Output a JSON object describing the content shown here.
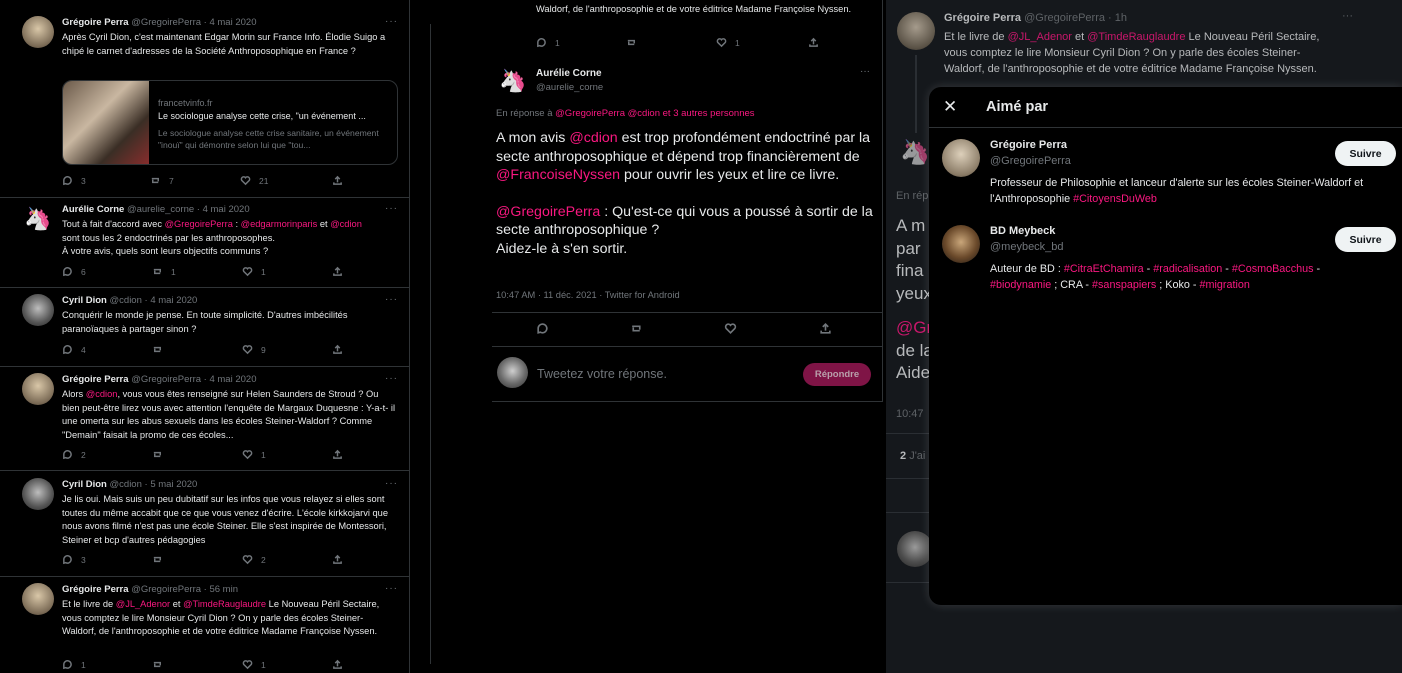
{
  "left_thread": {
    "tweets": [
      {
        "name": "Grégoire Perra",
        "handle": "@GregoirePerra",
        "time": "· 4 mai 2020",
        "text_parts": [
          "Après Cyril Dion, c'est maintenant Edgar Morin sur France Info. Élodie Suigo a chipé le carnet d'adresses de la Société Anthroposophique en France  ?"
        ],
        "card": {
          "domain": "francetvinfo.fr",
          "title": "Le sociologue analyse cette crise, \"un événement ...",
          "desc": "Le sociologue analyse cette crise sanitaire, un événement \"inouï\" qui démontre selon lui que \"tou..."
        },
        "replies": "3",
        "retweets": "7",
        "likes": "21"
      },
      {
        "name": "Aurélie Corne",
        "handle": "@aurelie_corne",
        "time": "· 4 mai 2020",
        "line1_a": "Tout à fait d'accord avec ",
        "m1": "@GregoirePerra",
        "line1_b": " : ",
        "m2": "@edgarmorinparis",
        "line1_c": " et ",
        "m3": "@cdion",
        "line2": "sont tous les 2 endoctrinés par les anthroposophes.",
        "line3": "À votre avis, quels sont leurs objectifs communs ?",
        "replies": "6",
        "retweets": "1",
        "likes": "1"
      },
      {
        "name": "Cyril Dion",
        "handle": "@cdion",
        "time": "· 4 mai 2020",
        "text": "Conquérir le monde je pense. En toute simplicité. D'autres imbécilités paranoïaques à partager sinon ?",
        "replies": "4",
        "retweets": "",
        "likes": "9"
      },
      {
        "name": "Grégoire Perra",
        "handle": "@GregoirePerra",
        "time": "· 4 mai 2020",
        "a": "Alors ",
        "m1": "@cdion",
        "b": ", vous vous êtes renseigné sur Helen Saunders de Stroud ? Ou bien peut-être lirez vous avec attention l'enquête de Margaux Duquesne : Y-a-t- il une omerta sur les abus sexuels dans les écoles Steiner-Waldorf ? Comme \"Demain\" faisait la promo de ces écoles...",
        "replies": "2",
        "retweets": "",
        "likes": "1"
      },
      {
        "name": "Cyril Dion",
        "handle": "@cdion",
        "time": "· 5 mai 2020",
        "text": "Je lis oui. Mais suis un peu dubitatif sur les infos que vous relayez si elles sont toutes du même accabit que ce que vous venez d'écrire. L'école kirkkojarvi que nous avons filmé n'est pas une école Steiner. Elle s'est inspirée de Montessori, Steiner et bcp d'autres pédagogies",
        "replies": "3",
        "retweets": "",
        "likes": "2"
      },
      {
        "name": "Grégoire Perra",
        "handle": "@GregoirePerra",
        "time": "· 56 min",
        "a": "Et le livre de ",
        "m1": "@JL_Adenor",
        "b": " et ",
        "m2": "@TimdeRauglaudre",
        "c": " Le Nouveau Péril Sectaire, vous comptez le lire Monsieur Cyril Dion ? On y parle des écoles Steiner-Waldorf, de l'anthroposophie et de votre éditrice Madame Françoise Nyssen.",
        "replies": "1",
        "retweets": "",
        "likes": "1"
      }
    ]
  },
  "middle": {
    "top_text": "Waldorf, de l'anthroposophie et de votre éditrice Madame Françoise Nyssen.",
    "top_replies": "1",
    "top_likes": "1",
    "name": "Aurélie Corne",
    "handle": "@aurelie_corne",
    "reply_to_prefix": "En réponse à ",
    "reply_to_m1": "@GregoirePerra",
    "reply_to_m2": "@cdion",
    "reply_to_suffix": " et 3 autres personnes",
    "p1a": "A mon avis ",
    "p1m1": "@cdion",
    "p1b": " est trop profondément endoctriné par la secte anthroposophique et dépend trop financièrement de ",
    "p1m2": "@FrancoiseNyssen",
    "p1c": " pour ouvrir les yeux et lire ce livre.",
    "p2m": "@GregoirePerra",
    "p2a": " : Qu'est-ce qui vous a poussé à sortir de la secte anthroposophique ?",
    "p3": "Aidez-le à s'en sortir.",
    "meta": "10:47 AM · 11 déc. 2021 · Twitter for Android",
    "reply_placeholder": "Tweetez votre réponse.",
    "reply_button": "Répondre"
  },
  "right": {
    "bg_name": "Grégoire Perra",
    "bg_handle": "@GregoirePerra",
    "bg_time": "· 1h",
    "bg_a": "Et le livre de ",
    "bg_m1": "@JL_Adenor",
    "bg_b": " et ",
    "bg_m2": "@TimdeRauglaudre",
    "bg_c": " Le Nouveau Péril Sectaire, vous comptez le lire Monsieur Cyril Dion ? On y parle des écoles Steiner-Waldorf, de l'anthroposophie et de votre éditrice Madame Françoise Nyssen.",
    "frag_enrep": "En rép",
    "frag_l1": "A m",
    "frag_l2": "par",
    "frag_l3": "fina",
    "frag_l4": "yeux",
    "frag_l5": "@Gr",
    "frag_l6": "de la",
    "frag_l7": "Aide",
    "frag_time": "10:47",
    "frag_count": "2",
    "frag_jai": "J'ai",
    "modal": {
      "title": "Aimé par",
      "users": [
        {
          "name": "Grégoire Perra",
          "handle": "@GregoirePerra",
          "follow": "Suivre",
          "bio_a": "Professeur de Philosophie et lanceur d'alerte sur les écoles Steiner-Waldorf et l'Anthroposophie ",
          "bio_tag": "#CitoyensDuWeb"
        },
        {
          "name": "BD Meybeck",
          "handle": "@meybeck_bd",
          "follow": "Suivre",
          "bio_a": "Auteur de BD : ",
          "t1": "#CitraEtChamira",
          "s1": " - ",
          "t2": "#radicalisation",
          "s2": " - ",
          "t3": "#CosmoBacchus",
          "s3": " -",
          "t4": "#biodynamie",
          "s4": " ; CRA - ",
          "t5": "#sanspapiers",
          "s5": " ; Koko - ",
          "t6": "#migration"
        }
      ]
    }
  }
}
